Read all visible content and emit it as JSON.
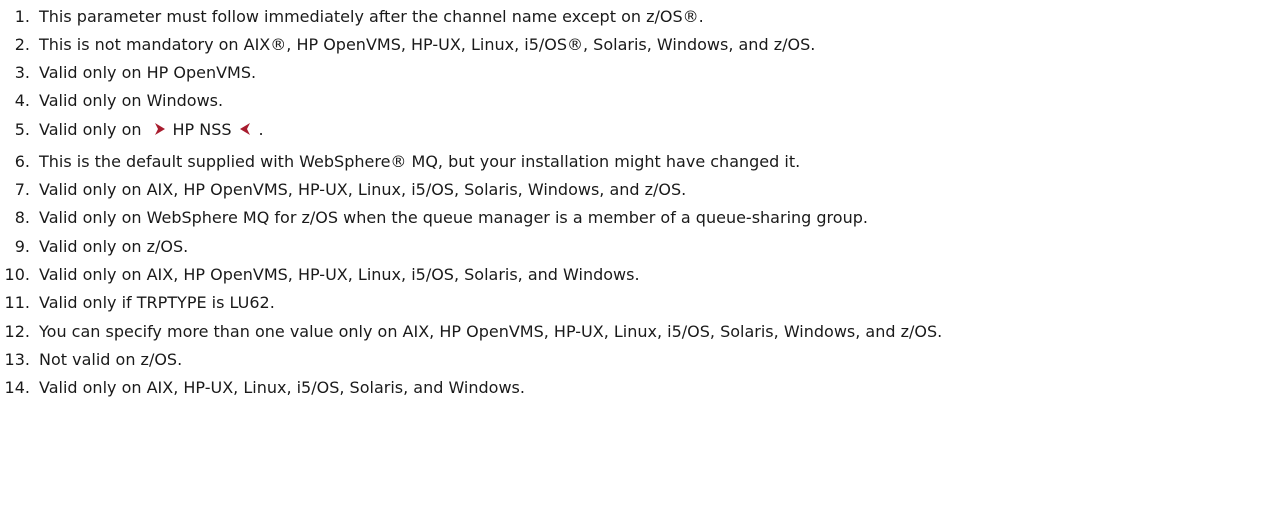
{
  "notes": [
    {
      "number": "1.",
      "text": "This parameter must follow immediately after the channel name except on z/OS®."
    },
    {
      "number": "2.",
      "text": "This is not mandatory on AIX®, HP OpenVMS, HP-UX, Linux, i5/OS®, Solaris, Windows, and z/OS."
    },
    {
      "number": "3.",
      "text": "Valid only on HP OpenVMS."
    },
    {
      "number": "4.",
      "text": "Valid only on Windows."
    },
    {
      "number": "5.",
      "text_before": "Valid only on",
      "text_marked": "HP NSS",
      "text_after": "."
    },
    {
      "number": "6.",
      "text": "This is the default supplied with WebSphere® MQ, but your installation might have changed it."
    },
    {
      "number": "7.",
      "text": "Valid only on AIX, HP OpenVMS, HP-UX, Linux, i5/OS, Solaris, Windows, and z/OS."
    },
    {
      "number": "8.",
      "text": "Valid only on WebSphere MQ for z/OS when the queue manager is a member of a queue-sharing group."
    },
    {
      "number": "9.",
      "text": "Valid only on z/OS."
    },
    {
      "number": "10.",
      "text": "Valid only on AIX, HP OpenVMS, HP-UX, Linux, i5/OS, Solaris, and Windows."
    },
    {
      "number": "11.",
      "text": "Valid only if TRPTYPE is LU62."
    },
    {
      "number": "12.",
      "text": "You can specify more than one value only on AIX, HP OpenVMS, HP-UX, Linux, i5/OS, Solaris, Windows, and z/OS."
    },
    {
      "number": "13.",
      "text": "Not valid on z/OS."
    },
    {
      "number": "14.",
      "text": "Valid only on AIX, HP-UX, Linux, i5/OS, Solaris, and Windows."
    }
  ],
  "change_marker": {
    "start_icon": "change-start-arrow-icon",
    "end_icon": "change-end-arrow-icon",
    "color": "#a81c2e"
  }
}
